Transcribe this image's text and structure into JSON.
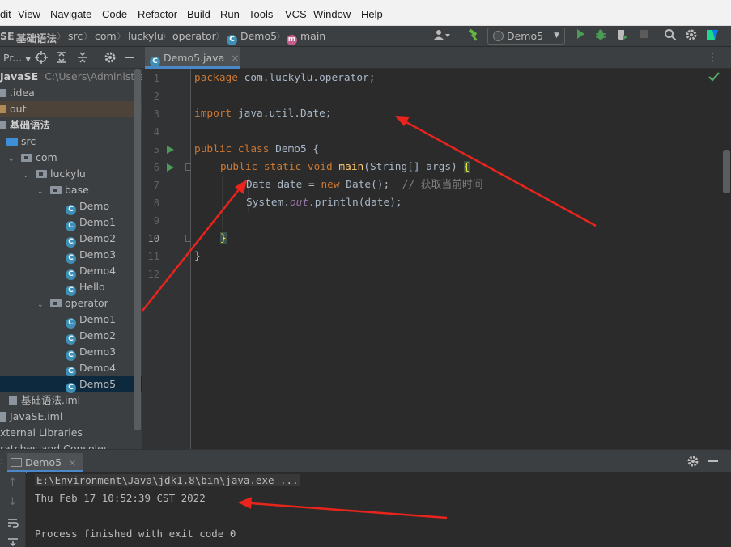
{
  "menu": [
    "dit",
    "View",
    "Navigate",
    "Code",
    "Refactor",
    "Build",
    "Run",
    "Tools",
    "VCS",
    "Window",
    "Help"
  ],
  "breadcrumb": {
    "items": [
      "SE",
      "基础语法",
      "src",
      "com",
      "luckylu",
      "operator",
      "Demo5",
      "main"
    ],
    "class_icon_letter": "C",
    "method_icon_letter": "m"
  },
  "toolbar": {
    "run_config": "Demo5",
    "run_config_arrow": "▼"
  },
  "project_panel": {
    "header_label": "Pr...",
    "rows": [
      {
        "label": "JavaSE",
        "extra": "C:\\Users\\Administrator\\",
        "kind": "root",
        "indent": 0
      },
      {
        "label": ".idea",
        "kind": "folder",
        "indent": 0
      },
      {
        "label": "out",
        "kind": "folder-out",
        "indent": 0
      },
      {
        "label": "基础语法",
        "kind": "folder",
        "indent": 0
      },
      {
        "label": "src",
        "kind": "folder-src",
        "indent": 1
      },
      {
        "label": "com",
        "kind": "pkg",
        "indent": 1
      },
      {
        "label": "luckylu",
        "kind": "pkg",
        "indent": 2
      },
      {
        "label": "base",
        "kind": "pkg",
        "indent": 3
      },
      {
        "label": "Demo",
        "kind": "class",
        "indent": 4
      },
      {
        "label": "Demo1",
        "kind": "class",
        "indent": 4
      },
      {
        "label": "Demo2",
        "kind": "class",
        "indent": 4
      },
      {
        "label": "Demo3",
        "kind": "class",
        "indent": 4
      },
      {
        "label": "Demo4",
        "kind": "class",
        "indent": 4
      },
      {
        "label": "Hello",
        "kind": "class",
        "indent": 4
      },
      {
        "label": "operator",
        "kind": "pkg",
        "indent": 3
      },
      {
        "label": "Demo1",
        "kind": "class",
        "indent": 4
      },
      {
        "label": "Demo2",
        "kind": "class",
        "indent": 4
      },
      {
        "label": "Demo3",
        "kind": "class",
        "indent": 4
      },
      {
        "label": "Demo4",
        "kind": "class",
        "indent": 4
      },
      {
        "label": "Demo5",
        "kind": "class",
        "indent": 4,
        "selected": true
      },
      {
        "label": "基础语法.iml",
        "kind": "iml",
        "indent": 1
      },
      {
        "label": "JavaSE.iml",
        "kind": "iml",
        "indent": 0
      },
      {
        "label": "xternal Libraries",
        "kind": "lib",
        "indent": 0
      },
      {
        "label": "ratches and Consoles",
        "kind": "lib",
        "indent": 0
      }
    ]
  },
  "editor": {
    "tab_label": "Demo5.java",
    "tab_close": "×",
    "line_numbers": [
      "1",
      "2",
      "3",
      "4",
      "5",
      "6",
      "7",
      "8",
      "9",
      "10",
      "11",
      "12"
    ],
    "code": {
      "l1_kw": "package",
      "l1_rest": " com.luckylu.operator;",
      "l3_kw": "import",
      "l3_rest": " java.util.Date;",
      "l5_kw": "public class",
      "l5_rest": " Demo5 {",
      "l6_kw": "public static void",
      "l6_fn": "main",
      "l6_rest": "(String[] args) ",
      "l6_brace": "{",
      "l7_a": "Date date = ",
      "l7_kw": "new",
      "l7_b": " Date();  ",
      "l7_cm": "// 获取当前时间",
      "l8_a": "System.",
      "l8_it": "out",
      "l8_b": ".println(date);",
      "l10_brace": "}",
      "l11": "}"
    }
  },
  "run_window": {
    "side_label": ":",
    "tab_label": "Demo5",
    "tab_close": "×",
    "lines": [
      "E:\\Environment\\Java\\jdk1.8\\bin\\java.exe ...",
      "Thu Feb 17 10:52:39 CST 2022",
      "",
      "Process finished with exit code 0"
    ]
  },
  "colors": {
    "annotation_arrow": "#e8241c",
    "run_green": "#499c54",
    "check_green": "#59a869"
  }
}
